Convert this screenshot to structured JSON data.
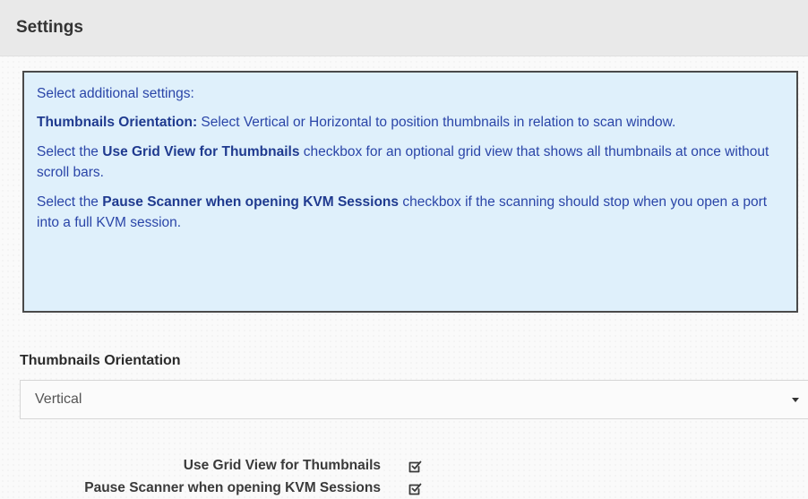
{
  "header": {
    "title": "Settings"
  },
  "info": {
    "intro": "Select additional settings:",
    "p1_bold": "Thumbnails Orientation:",
    "p1_rest": " Select Vertical or Horizontal to position thumbnails in relation to scan window.",
    "p2_pre": "Select the ",
    "p2_bold": "Use Grid View for Thumbnails",
    "p2_rest": " checkbox for an optional grid view that shows all thumbnails at once without scroll bars.",
    "p3_pre": "Select the ",
    "p3_bold": "Pause Scanner when opening KVM Sessions",
    "p3_rest": " checkbox if the scanning should stop when you open a port into a full KVM session."
  },
  "orientation": {
    "label": "Thumbnails Orientation",
    "value": "Vertical"
  },
  "options": {
    "grid_view_label": "Use Grid View for Thumbnails",
    "grid_view_checked": true,
    "pause_scanner_label": "Pause Scanner when opening KVM Sessions",
    "pause_scanner_checked": true
  },
  "colors": {
    "info_background": "#dff0fb",
    "info_text": "#2a45a8",
    "header_background": "#e9e9e9"
  }
}
